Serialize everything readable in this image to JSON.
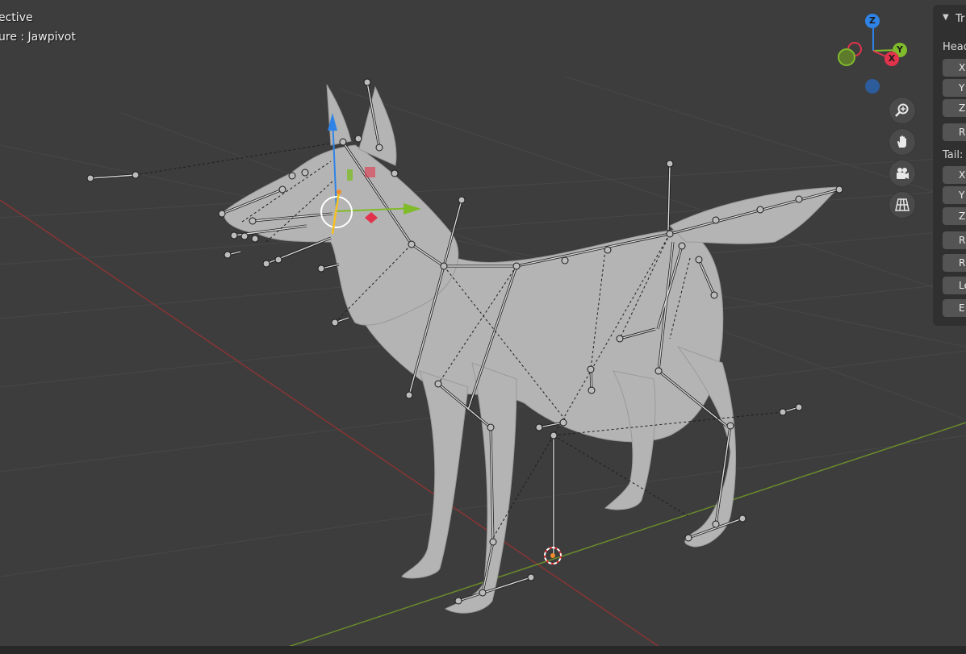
{
  "viewport": {
    "mode_label": "ective",
    "object_label": "ure : Jawpivot",
    "colors": {
      "background": "#3d3d3d",
      "x_axis_line": "#8a3434",
      "y_axis_line": "#6a8a2c",
      "mesh": "#b8b8b8"
    }
  },
  "gizmo": {
    "z_label": "Z",
    "y_label": "Y",
    "x_label": "X",
    "colors": {
      "x": "#e1334b",
      "y": "#80bb2b",
      "z": "#2f83e6"
    }
  },
  "nav_buttons": [
    {
      "icon": "zoom-icon"
    },
    {
      "icon": "hand-pan-icon"
    },
    {
      "icon": "camera-icon"
    },
    {
      "icon": "grid-view-icon"
    }
  ],
  "panel": {
    "header": "Tr",
    "head_label": "Head",
    "head_fields": [
      "X",
      "Y",
      "Z",
      "R"
    ],
    "tail_label": "Tail:",
    "tail_fields": [
      "X",
      "Y",
      "Z",
      "R",
      "R",
      "Le",
      "E"
    ]
  }
}
